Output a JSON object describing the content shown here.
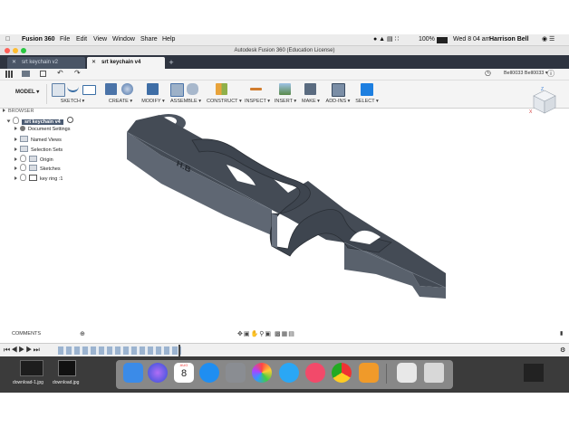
{
  "menubar": {
    "app": "Fusion 360",
    "items": [
      "File",
      "Edit",
      "View",
      "Window",
      "Share",
      "Help"
    ],
    "battery": "100%",
    "clock": "Wed 8 04 am",
    "user": "Harrison Bell"
  },
  "window_title": "Autodesk Fusion 360 (Education License)",
  "tabs": [
    {
      "label": "srt keychain v2",
      "active": false
    },
    {
      "label": "srt keychain v4",
      "active": true
    }
  ],
  "account": "Bell0033 Bell0033 ▾",
  "ribbon": {
    "workspace": "MODEL ▾",
    "groups": [
      "SKETCH ▾",
      "CREATE ▾",
      "MODIFY ▾",
      "ASSEMBLE ▾",
      "CONSTRUCT ▾",
      "INSPECT ▾",
      "INSERT ▾",
      "MAKE ▾",
      "ADD-INS ▾",
      "SELECT ▾"
    ]
  },
  "browser": {
    "header": "BROWSER",
    "root": "srt keychain v4",
    "items": [
      "Document Settings",
      "Named Views",
      "Selection Sets",
      "Origin",
      "Sketches",
      "key ring :1"
    ]
  },
  "model_text": "H.B",
  "viewcube": {
    "axis_z": "Z",
    "axis_x": "X"
  },
  "comments_label": "COMMENTS",
  "desktop_files": [
    "download-1.jpg",
    "download.jpg"
  ],
  "dock_calendar": {
    "month": "AUG",
    "day": "8"
  }
}
